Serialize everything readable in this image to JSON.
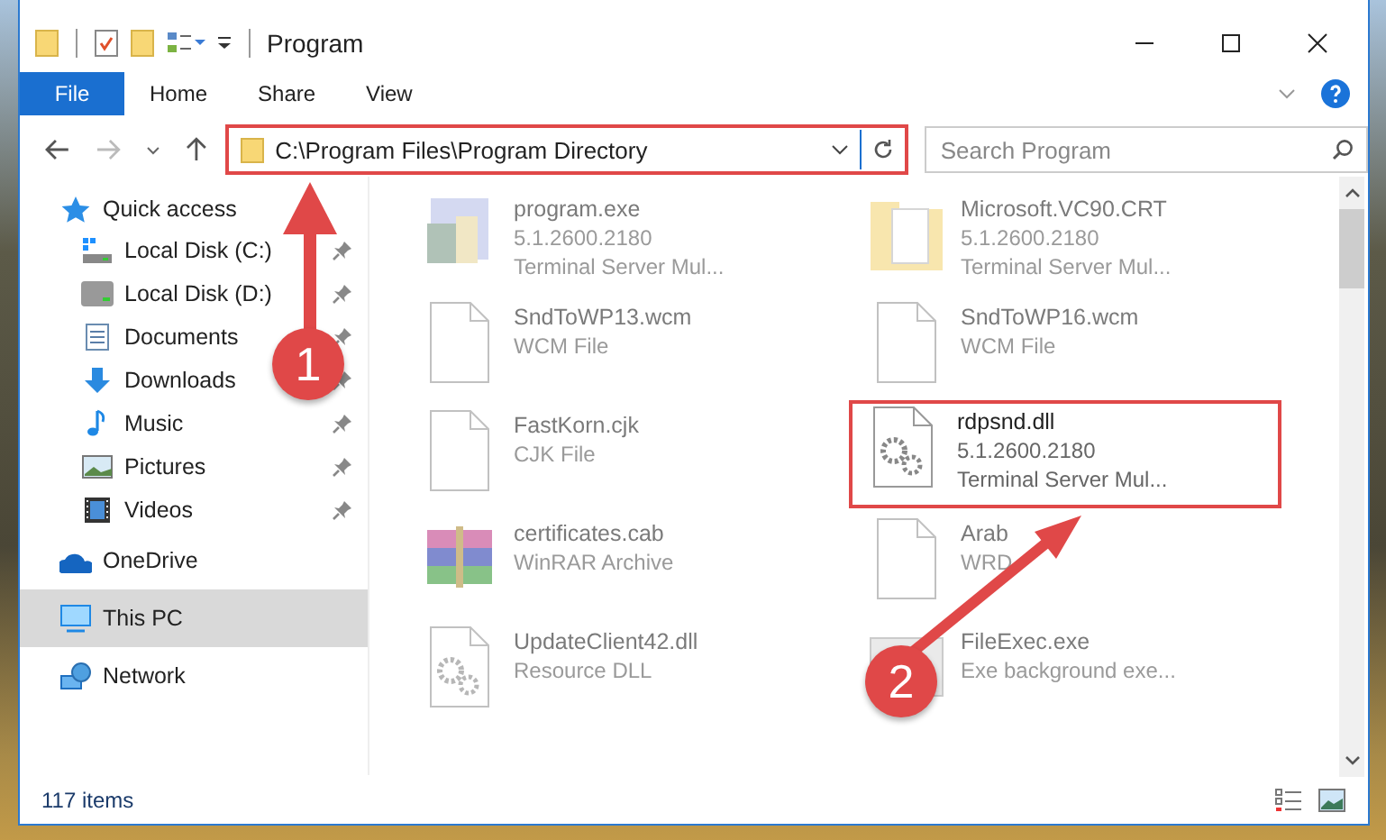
{
  "window": {
    "title": "Program"
  },
  "ribbon": {
    "file_button": "File",
    "tabs": [
      "Home",
      "Share",
      "View"
    ]
  },
  "address": {
    "path": "C:\\Program Files\\Program Directory",
    "highlighted": true
  },
  "search": {
    "placeholder": "Search Program"
  },
  "sidebar": {
    "items": [
      {
        "label": "Quick access",
        "selected": false,
        "children": [
          {
            "label": "Local Disk (C:)",
            "pinned": true,
            "selected": false
          },
          {
            "label": "Local Disk (D:)",
            "pinned": true,
            "selected": false
          },
          {
            "label": "Documents",
            "pinned": true,
            "selected": false
          },
          {
            "label": "Downloads",
            "pinned": true,
            "selected": false
          },
          {
            "label": "Music",
            "pinned": true,
            "selected": false
          },
          {
            "label": "Pictures",
            "pinned": true,
            "selected": false
          },
          {
            "label": "Videos",
            "pinned": true,
            "selected": false
          }
        ]
      },
      {
        "label": "OneDrive",
        "selected": false
      },
      {
        "label": "This PC",
        "selected": true
      },
      {
        "label": "Network",
        "selected": false
      }
    ]
  },
  "files": [
    {
      "name": "program.exe",
      "lines": [
        "5.1.2600.2180",
        "Terminal Server Mul..."
      ],
      "kind": "exe",
      "dimmed": true,
      "highlighted": false
    },
    {
      "name": "Microsoft.VC90.CRT",
      "lines": [
        "5.1.2600.2180",
        "Terminal Server Mul..."
      ],
      "kind": "folder",
      "dimmed": true,
      "highlighted": false
    },
    {
      "name": "SndToWP13.wcm",
      "lines": [
        "WCM File"
      ],
      "kind": "blank",
      "dimmed": true,
      "highlighted": false
    },
    {
      "name": "SndToWP16.wcm",
      "lines": [
        "WCM File"
      ],
      "kind": "blank",
      "dimmed": true,
      "highlighted": false
    },
    {
      "name": "FastKorn.cjk",
      "lines": [
        "CJK File"
      ],
      "kind": "blank",
      "dimmed": true,
      "highlighted": false
    },
    {
      "name": "rdpsnd.dll",
      "lines": [
        "5.1.2600.2180",
        "Terminal Server Mul..."
      ],
      "kind": "gear",
      "dimmed": false,
      "highlighted": true
    },
    {
      "name": "certificates.cab",
      "lines": [
        "WinRAR Archive"
      ],
      "kind": "rar",
      "dimmed": true,
      "highlighted": false
    },
    {
      "name": "Arab",
      "lines": [
        "WRD"
      ],
      "kind": "blank",
      "dimmed": true,
      "highlighted": false
    },
    {
      "name": "UpdateClient42.dll",
      "lines": [
        "Resource DLL"
      ],
      "kind": "gear",
      "dimmed": true,
      "highlighted": false
    },
    {
      "name": "FileExec.exe",
      "lines": [
        "Exe background exe..."
      ],
      "kind": "app",
      "dimmed": true,
      "highlighted": false
    }
  ],
  "status_bar": {
    "count": "117 items"
  },
  "callouts": [
    {
      "number": "1"
    },
    {
      "number": "2"
    }
  ]
}
